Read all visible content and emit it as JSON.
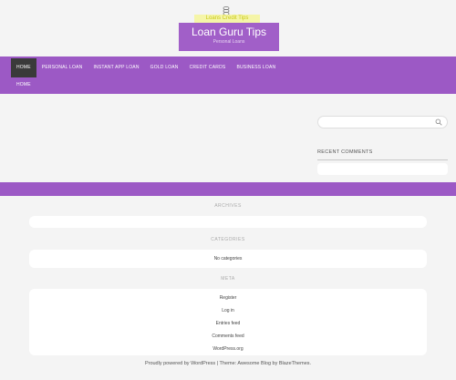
{
  "brand": {
    "tagline_top": "Loans Credit Tips",
    "title": "Loan Guru Tips",
    "description": "Personal Loans",
    "accent": "#9c59c5",
    "title_bg": "#a15fc8"
  },
  "nav": {
    "items": [
      {
        "label": "Home",
        "active": true
      },
      {
        "label": "Personal Loan"
      },
      {
        "label": "Instant App Loan"
      },
      {
        "label": "Gold Loan"
      },
      {
        "label": "Credit Cards"
      },
      {
        "label": "Business Loan"
      }
    ],
    "items_row2": [
      {
        "label": "Home"
      }
    ]
  },
  "sidebar": {
    "search": {
      "placeholder": "",
      "icon": "search-icon"
    },
    "recent_comments_title": "Recent Comments"
  },
  "widgets": {
    "archives_title": "Archives",
    "categories_title": "Categories",
    "categories_empty": "No categories",
    "meta_title": "Meta",
    "meta_items": [
      "Register",
      "Log in",
      "Entries feed",
      "Comments feed",
      "WordPress.org"
    ]
  },
  "footer": {
    "text": "Proudly powered by WordPress | Theme: Awesome Blog by BlazeThemes."
  }
}
